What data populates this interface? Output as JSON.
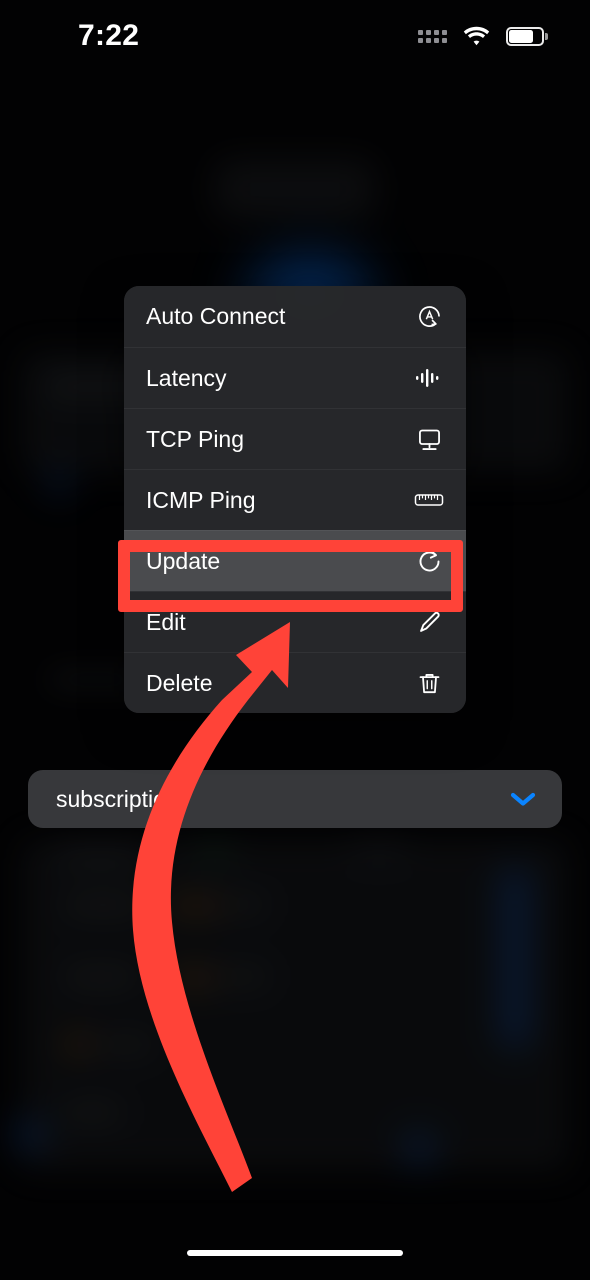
{
  "status_bar": {
    "time": "7:22",
    "signal_icon": "signal-dots-icon",
    "wifi_icon": "wifi-icon",
    "battery_icon": "battery-icon",
    "battery_level_pct": 75
  },
  "context_menu": {
    "items": [
      {
        "label": "Auto Connect",
        "icon": "auto-connect-icon",
        "highlighted": false
      },
      {
        "label": "Latency",
        "icon": "latency-waveform-icon",
        "highlighted": false
      },
      {
        "label": "TCP Ping",
        "icon": "monitor-icon",
        "highlighted": false
      },
      {
        "label": "ICMP Ping",
        "icon": "ruler-icon",
        "highlighted": false
      },
      {
        "label": "Update",
        "icon": "refresh-icon",
        "highlighted": true
      },
      {
        "label": "Edit",
        "icon": "pencil-icon",
        "highlighted": false
      },
      {
        "label": "Delete",
        "icon": "trash-icon",
        "highlighted": false
      }
    ]
  },
  "subscription_bar": {
    "label": "subscription",
    "chevron_icon": "chevron-down-icon",
    "chevron_color": "#0a84ff"
  },
  "annotation": {
    "highlight_target": "Update",
    "color": "#ff4338",
    "arrow_icon": "curved-arrow-icon"
  },
  "home_indicator": {
    "label": "home-indicator"
  },
  "colors": {
    "accent_blue": "#0a84ff",
    "annotation_red": "#ff4338",
    "menu_background": "#262729",
    "menu_highlight": "#4a4b4e"
  }
}
